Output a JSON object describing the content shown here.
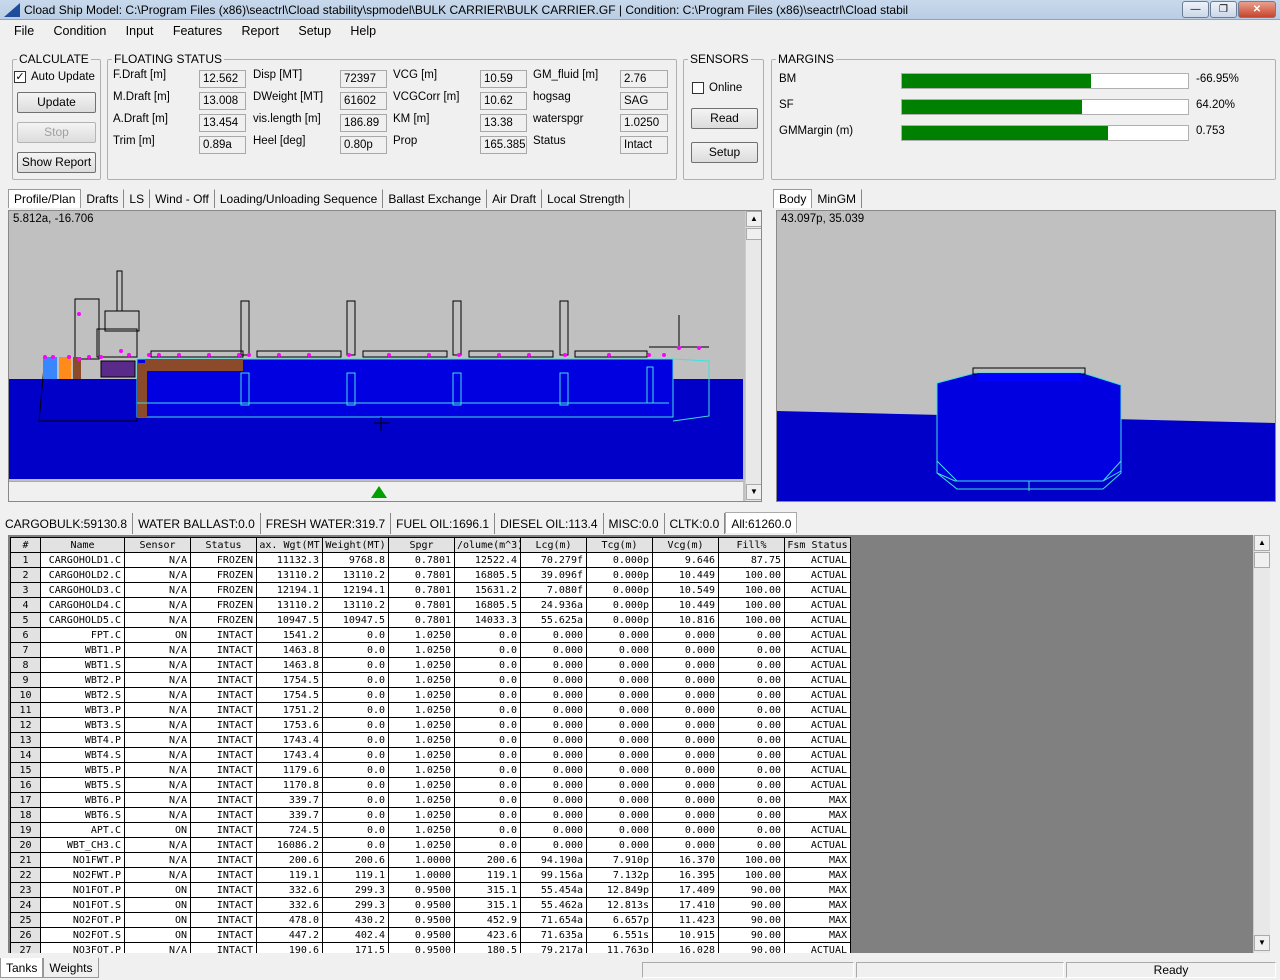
{
  "window": {
    "title": "Cload  Ship Model: C:\\Program Files (x86)\\seactrl\\Cload stability\\spmodel\\BULK CARRIER\\BULK CARRIER.GF | Condition: C:\\Program Files (x86)\\seactrl\\Cload stabil"
  },
  "menu": [
    "File",
    "Condition",
    "Input",
    "Features",
    "Report",
    "Setup",
    "Help"
  ],
  "calculate": {
    "legend": "CALCULATE",
    "auto_update_label": "Auto Update",
    "auto_update_checked": true,
    "update": "Update",
    "stop": "Stop",
    "show_report": "Show Report"
  },
  "floating_status": {
    "legend": "FLOATING STATUS",
    "fields": [
      {
        "label": "F.Draft [m]",
        "value": "12.562"
      },
      {
        "label": "Disp [MT]",
        "value": "72397"
      },
      {
        "label": "VCG [m]",
        "value": "10.59"
      },
      {
        "label": "GM_fluid [m]",
        "value": "2.76"
      },
      {
        "label": "M.Draft [m]",
        "value": "13.008"
      },
      {
        "label": "DWeight [MT]",
        "value": "61602"
      },
      {
        "label": "VCGCorr [m]",
        "value": "10.62"
      },
      {
        "label": "hogsag",
        "value": "SAG"
      },
      {
        "label": "A.Draft [m]",
        "value": "13.454"
      },
      {
        "label": "vis.length [m]",
        "value": "186.89"
      },
      {
        "label": "KM [m]",
        "value": "13.38"
      },
      {
        "label": "waterspgr",
        "value": "1.0250"
      },
      {
        "label": "Trim [m]",
        "value": "0.89a"
      },
      {
        "label": "Heel [deg]",
        "value": "0.80p"
      },
      {
        "label": "Prop",
        "value": "165.385"
      },
      {
        "label": "Status",
        "value": "Intact"
      }
    ]
  },
  "sensors": {
    "legend": "SENSORS",
    "online_label": "Online",
    "online_checked": false,
    "read": "Read",
    "setup": "Setup"
  },
  "margins": {
    "legend": "MARGINS",
    "rows": [
      {
        "label": "BM",
        "value": "-66.95%",
        "fill": 0.66
      },
      {
        "label": "SF",
        "value": "64.20%",
        "fill": 0.63
      },
      {
        "label": "GMMargin (m)",
        "value": "0.753",
        "fill": 0.72
      }
    ]
  },
  "profile_tabs": [
    "Profile/Plan",
    "Drafts",
    "LS",
    "Wind - Off",
    "Loading/Unloading Sequence",
    "Ballast Exchange",
    "Air Draft",
    "Local Strength"
  ],
  "profile_coord": "5.812a, -16.706",
  "body_tabs": [
    "Body",
    "MinGM"
  ],
  "body_coord": "43.097p, 35.039",
  "summary_tabs": [
    "CARGOBULK:59130.8",
    "WATER BALLAST:0.0",
    "FRESH WATER:319.7",
    "FUEL OIL:1696.1",
    "DIESEL OIL:113.4",
    "MISC:0.0",
    "CLTK:0.0",
    "All:61260.0"
  ],
  "table": {
    "headers": [
      "#",
      "Name",
      "Sensor",
      "Status",
      "ax. Wgt(MT",
      "Weight(MT)",
      "Spgr",
      "/olume(m^3)",
      "Lcg(m)",
      "Tcg(m)",
      "Vcg(m)",
      "Fill%",
      "Fsm Status"
    ],
    "rows": [
      [
        "1",
        "CARGOHOLD1.C",
        "N/A",
        "FROZEN",
        "11132.3",
        "9768.8",
        "0.7801",
        "12522.4",
        "70.279f",
        "0.000p",
        "9.646",
        "87.75",
        "ACTUAL"
      ],
      [
        "2",
        "CARGOHOLD2.C",
        "N/A",
        "FROZEN",
        "13110.2",
        "13110.2",
        "0.7801",
        "16805.5",
        "39.096f",
        "0.000p",
        "10.449",
        "100.00",
        "ACTUAL"
      ],
      [
        "3",
        "CARGOHOLD3.C",
        "N/A",
        "FROZEN",
        "12194.1",
        "12194.1",
        "0.7801",
        "15631.2",
        "7.080f",
        "0.000p",
        "10.549",
        "100.00",
        "ACTUAL"
      ],
      [
        "4",
        "CARGOHOLD4.C",
        "N/A",
        "FROZEN",
        "13110.2",
        "13110.2",
        "0.7801",
        "16805.5",
        "24.936a",
        "0.000p",
        "10.449",
        "100.00",
        "ACTUAL"
      ],
      [
        "5",
        "CARGOHOLD5.C",
        "N/A",
        "FROZEN",
        "10947.5",
        "10947.5",
        "0.7801",
        "14033.3",
        "55.625a",
        "0.000p",
        "10.816",
        "100.00",
        "ACTUAL"
      ],
      [
        "6",
        "FPT.C",
        "ON",
        "INTACT",
        "1541.2",
        "0.0",
        "1.0250",
        "0.0",
        "0.000",
        "0.000",
        "0.000",
        "0.00",
        "ACTUAL"
      ],
      [
        "7",
        "WBT1.P",
        "N/A",
        "INTACT",
        "1463.8",
        "0.0",
        "1.0250",
        "0.0",
        "0.000",
        "0.000",
        "0.000",
        "0.00",
        "ACTUAL"
      ],
      [
        "8",
        "WBT1.S",
        "N/A",
        "INTACT",
        "1463.8",
        "0.0",
        "1.0250",
        "0.0",
        "0.000",
        "0.000",
        "0.000",
        "0.00",
        "ACTUAL"
      ],
      [
        "9",
        "WBT2.P",
        "N/A",
        "INTACT",
        "1754.5",
        "0.0",
        "1.0250",
        "0.0",
        "0.000",
        "0.000",
        "0.000",
        "0.00",
        "ACTUAL"
      ],
      [
        "10",
        "WBT2.S",
        "N/A",
        "INTACT",
        "1754.5",
        "0.0",
        "1.0250",
        "0.0",
        "0.000",
        "0.000",
        "0.000",
        "0.00",
        "ACTUAL"
      ],
      [
        "11",
        "WBT3.P",
        "N/A",
        "INTACT",
        "1751.2",
        "0.0",
        "1.0250",
        "0.0",
        "0.000",
        "0.000",
        "0.000",
        "0.00",
        "ACTUAL"
      ],
      [
        "12",
        "WBT3.S",
        "N/A",
        "INTACT",
        "1753.6",
        "0.0",
        "1.0250",
        "0.0",
        "0.000",
        "0.000",
        "0.000",
        "0.00",
        "ACTUAL"
      ],
      [
        "13",
        "WBT4.P",
        "N/A",
        "INTACT",
        "1743.4",
        "0.0",
        "1.0250",
        "0.0",
        "0.000",
        "0.000",
        "0.000",
        "0.00",
        "ACTUAL"
      ],
      [
        "14",
        "WBT4.S",
        "N/A",
        "INTACT",
        "1743.4",
        "0.0",
        "1.0250",
        "0.0",
        "0.000",
        "0.000",
        "0.000",
        "0.00",
        "ACTUAL"
      ],
      [
        "15",
        "WBT5.P",
        "N/A",
        "INTACT",
        "1179.6",
        "0.0",
        "1.0250",
        "0.0",
        "0.000",
        "0.000",
        "0.000",
        "0.00",
        "ACTUAL"
      ],
      [
        "16",
        "WBT5.S",
        "N/A",
        "INTACT",
        "1170.8",
        "0.0",
        "1.0250",
        "0.0",
        "0.000",
        "0.000",
        "0.000",
        "0.00",
        "ACTUAL"
      ],
      [
        "17",
        "WBT6.P",
        "N/A",
        "INTACT",
        "339.7",
        "0.0",
        "1.0250",
        "0.0",
        "0.000",
        "0.000",
        "0.000",
        "0.00",
        "MAX"
      ],
      [
        "18",
        "WBT6.S",
        "N/A",
        "INTACT",
        "339.7",
        "0.0",
        "1.0250",
        "0.0",
        "0.000",
        "0.000",
        "0.000",
        "0.00",
        "MAX"
      ],
      [
        "19",
        "APT.C",
        "ON",
        "INTACT",
        "724.5",
        "0.0",
        "1.0250",
        "0.0",
        "0.000",
        "0.000",
        "0.000",
        "0.00",
        "ACTUAL"
      ],
      [
        "20",
        "WBT_CH3.C",
        "N/A",
        "INTACT",
        "16086.2",
        "0.0",
        "1.0250",
        "0.0",
        "0.000",
        "0.000",
        "0.000",
        "0.00",
        "ACTUAL"
      ],
      [
        "21",
        "NO1FWT.P",
        "N/A",
        "INTACT",
        "200.6",
        "200.6",
        "1.0000",
        "200.6",
        "94.190a",
        "7.910p",
        "16.370",
        "100.00",
        "MAX"
      ],
      [
        "22",
        "NO2FWT.P",
        "N/A",
        "INTACT",
        "119.1",
        "119.1",
        "1.0000",
        "119.1",
        "99.156a",
        "7.132p",
        "16.395",
        "100.00",
        "MAX"
      ],
      [
        "23",
        "NO1FOT.P",
        "ON",
        "INTACT",
        "332.6",
        "299.3",
        "0.9500",
        "315.1",
        "55.454a",
        "12.849p",
        "17.409",
        "90.00",
        "MAX"
      ],
      [
        "24",
        "NO1FOT.S",
        "ON",
        "INTACT",
        "332.6",
        "299.3",
        "0.9500",
        "315.1",
        "55.462a",
        "12.813s",
        "17.410",
        "90.00",
        "MAX"
      ],
      [
        "25",
        "NO2FOT.P",
        "ON",
        "INTACT",
        "478.0",
        "430.2",
        "0.9500",
        "452.9",
        "71.654a",
        "6.657p",
        "11.423",
        "90.00",
        "MAX"
      ],
      [
        "26",
        "NO2FOT.S",
        "ON",
        "INTACT",
        "447.2",
        "402.4",
        "0.9500",
        "423.6",
        "71.635a",
        "6.551s",
        "10.915",
        "90.00",
        "MAX"
      ],
      [
        "27",
        "NO3FOT.P",
        "N/A",
        "INTACT",
        "190.6",
        "171.5",
        "0.9500",
        "180.5",
        "79.217a",
        "11.763p",
        "16.028",
        "90.00",
        "ACTUAL"
      ]
    ]
  },
  "bottom_tabs": [
    "Tanks",
    "Weights"
  ],
  "status_text": "Ready"
}
